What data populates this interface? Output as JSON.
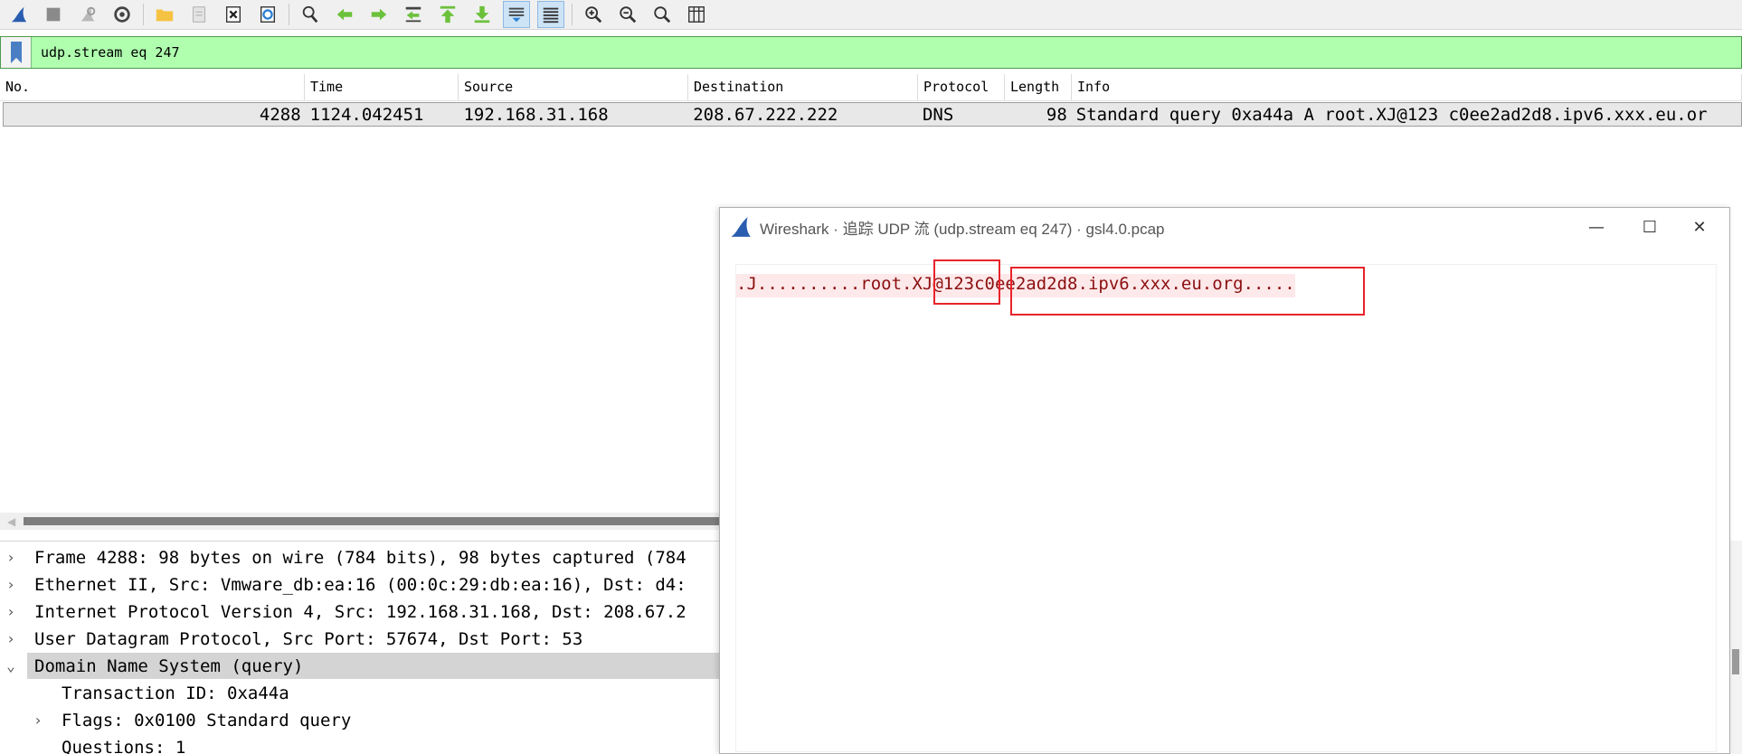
{
  "toolbar": {
    "buttons": [
      "shark-fin-icon",
      "stop-icon",
      "restart-icon",
      "options-icon",
      "open-folder-icon",
      "save-file-icon",
      "close-file-icon",
      "reload-icon",
      "find-icon",
      "go-back-icon",
      "go-forward-icon",
      "go-to-packet-icon",
      "first-packet-icon",
      "last-packet-icon",
      "autoscroll-icon",
      "colorize-icon",
      "zoom-in-icon",
      "zoom-out-icon",
      "normal-size-icon",
      "resize-columns-icon"
    ]
  },
  "filter": {
    "value": "udp.stream eq 247"
  },
  "packet_list": {
    "columns": [
      "No.",
      "Time",
      "Source",
      "Destination",
      "Protocol",
      "Length",
      "Info"
    ],
    "rows": [
      {
        "no": "4288",
        "time": "1124.042451",
        "source": "192.168.31.168",
        "destination": "208.67.222.222",
        "protocol": "DNS",
        "length": "98",
        "info": "Standard query 0xa44a A root.XJ@123 c0ee2ad2d8.ipv6.xxx.eu.or"
      }
    ]
  },
  "details": {
    "rows": [
      {
        "arrow": "›",
        "text": "Frame 4288: 98 bytes on wire (784 bits), 98 bytes captured (784"
      },
      {
        "arrow": "›",
        "text": "Ethernet II, Src: Vmware_db:ea:16 (00:0c:29:db:ea:16), Dst: d4:"
      },
      {
        "arrow": "›",
        "text": "Internet Protocol Version 4, Src: 192.168.31.168, Dst: 208.67.2"
      },
      {
        "arrow": "›",
        "text": "User Datagram Protocol, Src Port: 57674, Dst Port: 53"
      },
      {
        "arrow": "⌄",
        "text": "Domain Name System (query)"
      },
      {
        "arrow": "",
        "text": "Transaction ID: 0xa44a"
      },
      {
        "arrow": "›",
        "text": "Flags: 0x0100 Standard query"
      },
      {
        "arrow": "",
        "text": "Questions: 1"
      }
    ]
  },
  "dialog": {
    "title": "Wireshark · 追踪 UDP 流 (udp.stream eq 247) · gsl4.0.pcap",
    "stream_part1": ".J..........root.",
    "stream_part2": "XJ@123",
    "stream_part3": " c0ee2ad2d8.ipv6.xxx.eu.org.....",
    "minimize": "—",
    "maximize": "☐",
    "close": "✕"
  },
  "colors": {
    "filter_bg": "#afffaf",
    "stream_text": "#8b0f0f",
    "stream_bg": "#fde8ea",
    "highlight_box": "#e8232a"
  }
}
